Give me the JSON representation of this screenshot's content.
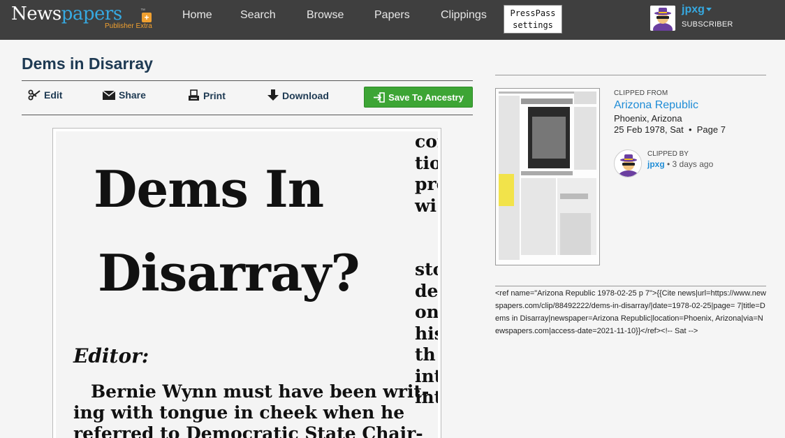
{
  "header": {
    "logo": {
      "text_part1": "News",
      "text_part2": "papers",
      "tm": "™",
      "sub": "Publisher Extra"
    },
    "nav": [
      "Home",
      "Search",
      "Browse",
      "Papers",
      "Clippings"
    ],
    "presspass": {
      "line1": "PressPass",
      "line2": "settings"
    },
    "user": {
      "name": "jpxg",
      "role": "SUBSCRIBER"
    }
  },
  "clip": {
    "title": "Dems in Disarray",
    "actions": {
      "edit": "Edit",
      "share": "Share",
      "print": "Print",
      "download": "Download",
      "ancestry": "Save To Ancestry"
    },
    "image_text": {
      "headline_line1": "Dems In",
      "headline_line2": "Disarray?",
      "editor": "Editor:",
      "body_line1": "Bernie Wynn must have been writ-",
      "body_line2": "ing with tongue in cheek when he",
      "body_line3": "referred to Democratic State Chair-",
      "side_fragments": [
        "cor",
        "tio",
        "pro",
        "wi",
        "",
        "sto",
        "de",
        "on",
        "his",
        "th",
        "int",
        "int"
      ]
    }
  },
  "sidebar": {
    "clipped_from_label": "CLIPPED FROM",
    "paper_name": "Arizona Republic",
    "paper_location": "Phoenix, Arizona",
    "paper_date": "25 Feb 1978, Sat",
    "page": "Page 7",
    "clipped_by_label": "CLIPPED BY",
    "clipper_name": "jpxg",
    "clipped_when": "3 days ago",
    "citation": "<ref name=\"Arizona Republic 1978-02-25 p 7\">{{Cite news|url=https://www.newspapers.com/clip/88492222/dems-in-disarray/|date=1978-02-25|page= 7|title=Dems in Disarray|newspaper=Arizona Republic|location=Phoenix, Arizona|via=Newspapers.com|access-date=2021-11-10}}</ref><!-- Sat -->"
  },
  "colors": {
    "topbar": "#3f3f3f",
    "link_blue": "#1f8cd6",
    "logo_blue": "#36a9e1",
    "ancestry_green": "#3da535",
    "title_navy": "#1e3a53"
  }
}
